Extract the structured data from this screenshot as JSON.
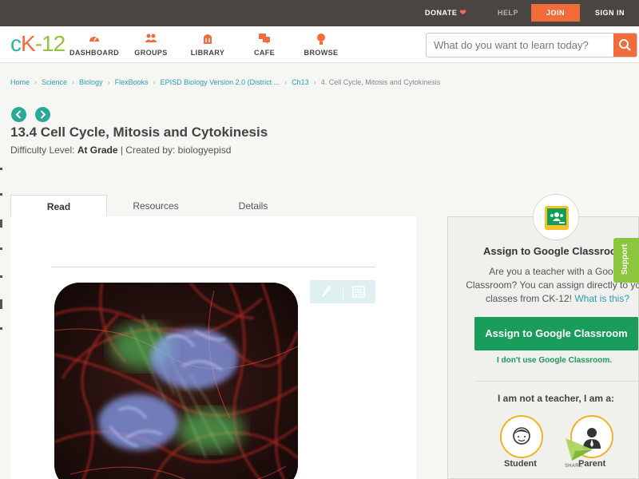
{
  "topbar": {
    "donate": "DONATE",
    "help": "HELP",
    "join": "JOIN",
    "sign_in": "SIGN IN"
  },
  "logo": {
    "c": "c",
    "k": "K",
    "dash": "-",
    "num": "12"
  },
  "nav": [
    {
      "label": "DASHBOARD",
      "icon": "dashboard-icon"
    },
    {
      "label": "GROUPS",
      "icon": "groups-icon"
    },
    {
      "label": "LIBRARY",
      "icon": "library-icon"
    },
    {
      "label": "CAFE",
      "icon": "cafe-icon"
    },
    {
      "label": "BROWSE",
      "icon": "browse-icon"
    }
  ],
  "search": {
    "placeholder": "What do you want to learn today?"
  },
  "breadcrumb": [
    "Home",
    "Science",
    "Biology",
    "FlexBooks",
    "EPISD Biology Version 2.0 (District ...",
    "Ch13",
    "4. Cell Cycle, Mitosis and Cytokinesis"
  ],
  "page": {
    "title": "13.4 Cell Cycle, Mitosis and Cytokinesis",
    "difficulty_label": "Difficulty Level: ",
    "difficulty_value": "At Grade",
    "created_by": " | Created by: biologyepisd"
  },
  "tabs": [
    "Read",
    "Resources",
    "Details"
  ],
  "panel": {
    "title": "Assign to Google Classroom",
    "text_line1": "Are you a teacher with a Google",
    "text_line2": "Classroom? You can assign directly to your",
    "text_line3": "classes from CK-12! ",
    "what_is_this": "What is this?",
    "assign_button": "Assign to Google Classroom",
    "no_gc": "I don't use Google Classroom.",
    "not_teacher": "I am not a teacher, I am a:",
    "student": "Student",
    "parent": "Parent",
    "share": "SHARE"
  },
  "support": "Support",
  "colors": {
    "accent_orange": "#f26b3a",
    "teal": "#2aa89a",
    "green": "#1a9c5b",
    "support_green": "#8cc63e"
  }
}
